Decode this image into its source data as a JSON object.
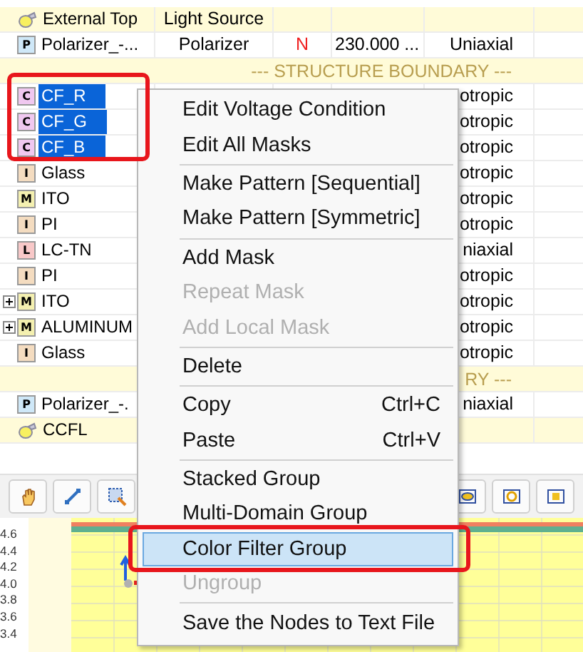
{
  "tree_table": {
    "rows": [
      {
        "kind": "light",
        "name": "External Top",
        "type": "Light Source"
      },
      {
        "kind": "layer",
        "badge": "P",
        "color": "#cfe8f8",
        "name": "Polarizer_-...",
        "selected": false,
        "type": "Polarizer",
        "flag": "N",
        "value": "230.000 ...",
        "optics": "Uniaxial"
      },
      {
        "kind": "boundary",
        "text": "--- STRUCTURE BOUNDARY ---"
      },
      {
        "kind": "layer",
        "badge": "C",
        "color": "#f0c8f0",
        "name": "CF_R",
        "selected": true,
        "optics": "otropic"
      },
      {
        "kind": "layer",
        "badge": "C",
        "color": "#f0c8f0",
        "name": "CF_G",
        "selected": true,
        "optics": "otropic"
      },
      {
        "kind": "layer",
        "badge": "C",
        "color": "#f0c8f0",
        "name": "CF_B",
        "selected": true,
        "optics": "otropic"
      },
      {
        "kind": "layer",
        "badge": "I",
        "color": "#f4dcc0",
        "name": "Glass",
        "selected": false,
        "optics": "otropic"
      },
      {
        "kind": "layer",
        "badge": "M",
        "color": "#f4f0b0",
        "name": "ITO",
        "selected": false,
        "optics": "otropic"
      },
      {
        "kind": "layer",
        "badge": "I",
        "color": "#f4dcc0",
        "name": "PI",
        "selected": false,
        "optics": "otropic"
      },
      {
        "kind": "layer",
        "badge": "L",
        "color": "#f8c8c8",
        "name": "LC-TN",
        "selected": false,
        "optics": "niaxial"
      },
      {
        "kind": "layer",
        "badge": "I",
        "color": "#f4dcc0",
        "name": "PI",
        "selected": false,
        "optics": "otropic"
      },
      {
        "kind": "layer",
        "badge": "M",
        "color": "#f4f0b0",
        "name": "ITO",
        "selected": false,
        "expanded": false,
        "optics": "otropic"
      },
      {
        "kind": "layer",
        "badge": "M",
        "color": "#f4f0b0",
        "name": "ALUMINUM",
        "selected": false,
        "expanded": false,
        "optics": "otropic"
      },
      {
        "kind": "layer",
        "badge": "I",
        "color": "#f4dcc0",
        "name": "Glass",
        "selected": false,
        "optics": "otropic"
      },
      {
        "kind": "boundary",
        "text": "RY ---"
      },
      {
        "kind": "layer",
        "badge": "P",
        "color": "#cfe8f8",
        "name": "Polarizer_-.",
        "selected": false,
        "optics": "niaxial"
      },
      {
        "kind": "light",
        "name": "CCFL"
      }
    ]
  },
  "context_menu": [
    {
      "kind": "item",
      "label": "Edit Voltage Condition",
      "disabled": false,
      "selected": false
    },
    {
      "kind": "item",
      "label": "Edit All Masks",
      "disabled": false,
      "selected": false
    },
    {
      "kind": "separator"
    },
    {
      "kind": "item",
      "label": "Make Pattern [Sequential]",
      "disabled": false,
      "selected": false
    },
    {
      "kind": "item",
      "label": "Make Pattern [Symmetric]",
      "disabled": false,
      "selected": false
    },
    {
      "kind": "separator"
    },
    {
      "kind": "item",
      "label": "Add Mask",
      "disabled": false,
      "selected": false
    },
    {
      "kind": "item",
      "label": "Repeat Mask",
      "disabled": true,
      "selected": false
    },
    {
      "kind": "item",
      "label": "Add Local Mask",
      "disabled": true,
      "selected": false
    },
    {
      "kind": "separator"
    },
    {
      "kind": "item",
      "label": "Delete",
      "disabled": false,
      "selected": false
    },
    {
      "kind": "separator"
    },
    {
      "kind": "item",
      "label": "Copy",
      "shortcut": "Ctrl+C",
      "disabled": false,
      "selected": false
    },
    {
      "kind": "item",
      "label": "Paste",
      "shortcut": "Ctrl+V",
      "disabled": false,
      "selected": false
    },
    {
      "kind": "separator"
    },
    {
      "kind": "item",
      "label": "Stacked Group",
      "disabled": false,
      "selected": false
    },
    {
      "kind": "item",
      "label": "Multi-Domain Group",
      "disabled": false,
      "selected": false
    },
    {
      "kind": "item",
      "label": "Color Filter Group",
      "disabled": false,
      "selected": true
    },
    {
      "kind": "item",
      "label": "Ungroup",
      "disabled": true,
      "selected": false
    },
    {
      "kind": "separator"
    },
    {
      "kind": "item",
      "label": "Save the Nodes to Text File",
      "disabled": false,
      "selected": false
    }
  ],
  "plot": {
    "y_ticks": [
      "4.6",
      "4.4",
      "4.2",
      "4.0",
      "3.8",
      "3.6",
      "3.4"
    ]
  }
}
